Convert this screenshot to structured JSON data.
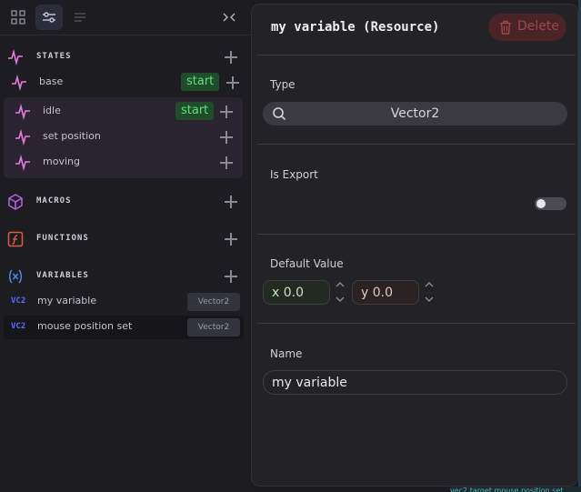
{
  "sidebar": {
    "sections": {
      "states": {
        "title": "STATES"
      },
      "macros": {
        "title": "MACROS"
      },
      "functions": {
        "title": "FUNCTIONS"
      },
      "variables": {
        "title": "VARIABLES"
      }
    },
    "states": [
      {
        "label": "base",
        "badge": "start"
      },
      {
        "label": "idle",
        "badge": "start"
      },
      {
        "label": "set position",
        "badge": ""
      },
      {
        "label": "moving",
        "badge": ""
      }
    ],
    "variables": [
      {
        "icon": "vec2-icon",
        "icon_text": "VC2",
        "label": "my variable",
        "type": "Vector2"
      },
      {
        "icon": "vec2-icon",
        "icon_text": "VC2",
        "label": "mouse position set",
        "type": "Vector2"
      }
    ]
  },
  "panel": {
    "title": "my variable (Resource)",
    "delete_label": "Delete",
    "type_label": "Type",
    "type_value": "Vector2",
    "is_export_label": "Is Export",
    "is_export_value": false,
    "default_value_label": "Default Value",
    "x_value": "x 0.0",
    "y_value": "y 0.0",
    "name_label": "Name",
    "name_value": "my variable"
  },
  "colors": {
    "state_icon": "#e87be0",
    "macro_icon": "#b066e6",
    "function_icon": "#e05a4a",
    "variable_icon": "#4a8fe8",
    "start_badge_bg": "#1f4d2c",
    "start_badge_text": "#5ee07a",
    "delete_text": "#9b4a4a"
  },
  "background_snippet": "vec2 target mouse position set"
}
